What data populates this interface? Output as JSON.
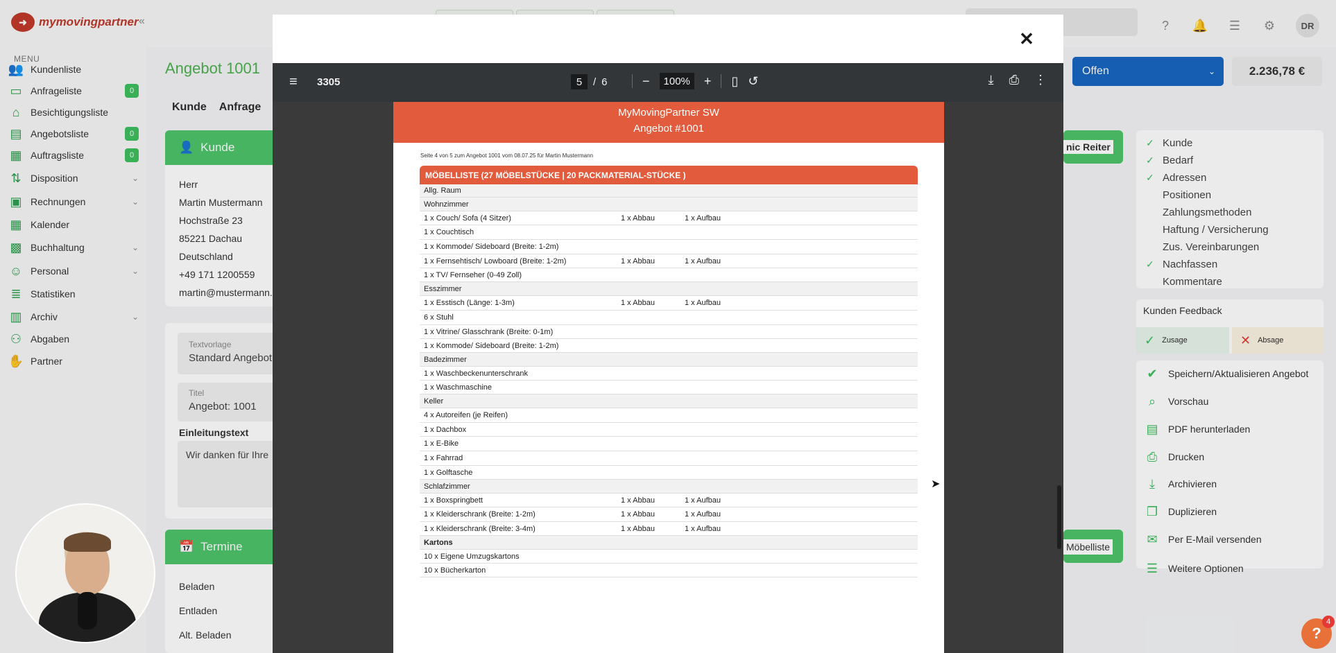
{
  "app": {
    "logo_text": "mymovingpartner",
    "user_initials": "DR",
    "menu_title": "MENU"
  },
  "sidebar": {
    "items": [
      {
        "label": "Kundenliste",
        "icon": "users-icon",
        "badge": "",
        "chevron": false
      },
      {
        "label": "Anfrageliste",
        "icon": "inbox-icon",
        "badge": "0",
        "chevron": false
      },
      {
        "label": "Besichtigungsliste",
        "icon": "house-icon",
        "badge": "",
        "chevron": false
      },
      {
        "label": "Angebotsliste",
        "icon": "document-icon",
        "badge": "0",
        "chevron": false
      },
      {
        "label": "Auftragsliste",
        "icon": "clipboard-icon",
        "badge": "0",
        "chevron": false
      },
      {
        "label": "Disposition",
        "icon": "dispatch-icon",
        "badge": "",
        "chevron": true
      },
      {
        "label": "Rechnungen",
        "icon": "invoice-icon",
        "badge": "",
        "chevron": true
      },
      {
        "label": "Kalender",
        "icon": "calendar-icon",
        "badge": "",
        "chevron": false
      },
      {
        "label": "Buchhaltung",
        "icon": "accounting-icon",
        "badge": "",
        "chevron": true
      },
      {
        "label": "Personal",
        "icon": "personnel-icon",
        "badge": "",
        "chevron": true
      },
      {
        "label": "Statistiken",
        "icon": "statistics-icon",
        "badge": "",
        "chevron": false
      },
      {
        "label": "Archiv",
        "icon": "archive-icon",
        "badge": "",
        "chevron": true
      },
      {
        "label": "Abgaben",
        "icon": "network-icon",
        "badge": "",
        "chevron": false
      },
      {
        "label": "Partner",
        "icon": "handshake-icon",
        "badge": "",
        "chevron": false
      }
    ]
  },
  "main": {
    "title": "Angebot 1001",
    "tabs": [
      "Kunde",
      "Anfrage"
    ],
    "kunde_card_title": "Kunde",
    "kunde_lines": [
      "Herr",
      "Martin Mustermann",
      "Hochstraße 23",
      "85221 Dachau",
      "Deutschland",
      "+49 171 1200559",
      "martin@mustermann.c"
    ],
    "textvorlage_label": "Textvorlage",
    "textvorlage_value": "Standard Angebot",
    "titel_label": "Titel",
    "titel_value": "Angebot: 1001",
    "einleitung_label": "Einleitungstext",
    "einleitung_value": "Wir danken für Ihre",
    "termine_title": "Termine",
    "termine_lines": [
      "Beladen",
      "Entladen",
      "Alt. Beladen"
    ],
    "dynamic_tab_label": "nic Reiter",
    "moebelliste_btn": "Möbelliste"
  },
  "right": {
    "status": "Offen",
    "amount": "2.236,78 €",
    "checklist": [
      {
        "label": "Kunde",
        "checked": true
      },
      {
        "label": "Bedarf",
        "checked": true
      },
      {
        "label": "Adressen",
        "checked": true
      },
      {
        "label": "Positionen",
        "checked": false
      },
      {
        "label": "Zahlungsmethoden",
        "checked": false
      },
      {
        "label": "Haftung / Versicherung",
        "checked": false
      },
      {
        "label": "Zus. Vereinbarungen",
        "checked": false
      },
      {
        "label": "Nachfassen",
        "checked": true
      },
      {
        "label": "Kommentare",
        "checked": false
      }
    ],
    "feedback_title": "Kunden Feedback",
    "zusage": "Zusage",
    "absage": "Absage",
    "actions": [
      {
        "label": "Speichern/Aktualisieren Angebot",
        "icon": "save-check-icon"
      },
      {
        "label": "Vorschau",
        "icon": "magnifier-icon"
      },
      {
        "label": "PDF herunterladen",
        "icon": "pdf-icon"
      },
      {
        "label": "Drucken",
        "icon": "printer-icon"
      },
      {
        "label": "Archivieren",
        "icon": "archive-download-icon"
      },
      {
        "label": "Duplizieren",
        "icon": "duplicate-icon"
      },
      {
        "label": "Per E-Mail versenden",
        "icon": "mail-icon"
      },
      {
        "label": "Weitere Optionen",
        "icon": "menu-lines-icon"
      }
    ]
  },
  "help_badge": "4",
  "viewer": {
    "doc_title": "3305",
    "page_current": "5",
    "page_sep": "/",
    "page_total": "6",
    "zoom": "100%"
  },
  "pdf": {
    "company": "MyMovingPartner SW",
    "doc_name": "Angebot #1001",
    "meta": "Seite 4 von 5 zum Angebot 1001 vom 08.07.25 für Martin Mustermann",
    "list_title": "MÖBELLISTE (27 MÖBELSTÜCKE | 20 PACKMATERIAL-STÜCKE )",
    "rows": [
      {
        "item": "Allg. Raum",
        "room": true,
        "bold": false,
        "abbau": "",
        "aufbau": ""
      },
      {
        "item": "Wohnzimmer",
        "room": true,
        "bold": false,
        "abbau": "",
        "aufbau": ""
      },
      {
        "item": "1 x Couch/ Sofa (4 Sitzer)",
        "room": false,
        "bold": false,
        "abbau": "1 x Abbau",
        "aufbau": "1 x Aufbau"
      },
      {
        "item": "1 x Couchtisch",
        "room": false,
        "bold": false,
        "abbau": "",
        "aufbau": ""
      },
      {
        "item": "1 x Kommode/ Sideboard (Breite: 1-2m)",
        "room": false,
        "bold": false,
        "abbau": "",
        "aufbau": ""
      },
      {
        "item": "1 x Fernsehtisch/ Lowboard (Breite: 1-2m)",
        "room": false,
        "bold": false,
        "abbau": "1 x Abbau",
        "aufbau": "1 x Aufbau"
      },
      {
        "item": "1 x TV/ Fernseher (0-49 Zoll)",
        "room": false,
        "bold": false,
        "abbau": "",
        "aufbau": ""
      },
      {
        "item": "Esszimmer",
        "room": true,
        "bold": false,
        "abbau": "",
        "aufbau": ""
      },
      {
        "item": "1 x Esstisch (Länge: 1-3m)",
        "room": false,
        "bold": false,
        "abbau": "1 x Abbau",
        "aufbau": "1 x Aufbau"
      },
      {
        "item": "6 x Stuhl",
        "room": false,
        "bold": false,
        "abbau": "",
        "aufbau": ""
      },
      {
        "item": "1 x Vitrine/ Glasschrank (Breite: 0-1m)",
        "room": false,
        "bold": false,
        "abbau": "",
        "aufbau": ""
      },
      {
        "item": "1 x Kommode/ Sideboard (Breite: 1-2m)",
        "room": false,
        "bold": false,
        "abbau": "",
        "aufbau": ""
      },
      {
        "item": "Badezimmer",
        "room": true,
        "bold": false,
        "abbau": "",
        "aufbau": ""
      },
      {
        "item": "1 x Waschbeckenunterschrank",
        "room": false,
        "bold": false,
        "abbau": "",
        "aufbau": ""
      },
      {
        "item": "1 x Waschmaschine",
        "room": false,
        "bold": false,
        "abbau": "",
        "aufbau": ""
      },
      {
        "item": "Keller",
        "room": true,
        "bold": false,
        "abbau": "",
        "aufbau": ""
      },
      {
        "item": "4 x Autoreifen (je Reifen)",
        "room": false,
        "bold": false,
        "abbau": "",
        "aufbau": ""
      },
      {
        "item": "1 x Dachbox",
        "room": false,
        "bold": false,
        "abbau": "",
        "aufbau": ""
      },
      {
        "item": "1 x E-Bike",
        "room": false,
        "bold": false,
        "abbau": "",
        "aufbau": ""
      },
      {
        "item": "1 x Fahrrad",
        "room": false,
        "bold": false,
        "abbau": "",
        "aufbau": ""
      },
      {
        "item": "1 x Golftasche",
        "room": false,
        "bold": false,
        "abbau": "",
        "aufbau": ""
      },
      {
        "item": "Schlafzimmer",
        "room": true,
        "bold": false,
        "abbau": "",
        "aufbau": ""
      },
      {
        "item": "1 x Boxspringbett",
        "room": false,
        "bold": false,
        "abbau": "1 x Abbau",
        "aufbau": "1 x Aufbau"
      },
      {
        "item": "1 x Kleiderschrank (Breite: 1-2m)",
        "room": false,
        "bold": false,
        "abbau": "1 x Abbau",
        "aufbau": "1 x Aufbau"
      },
      {
        "item": "1 x Kleiderschrank (Breite: 3-4m)",
        "room": false,
        "bold": false,
        "abbau": "1 x Abbau",
        "aufbau": "1 x Aufbau"
      },
      {
        "item": "Kartons",
        "room": true,
        "bold": true,
        "abbau": "",
        "aufbau": ""
      },
      {
        "item": "10 x Eigene Umzugskartons",
        "room": false,
        "bold": false,
        "abbau": "",
        "aufbau": ""
      },
      {
        "item": "10 x Bücherkarton",
        "room": false,
        "bold": false,
        "abbau": "",
        "aufbau": ""
      }
    ]
  }
}
